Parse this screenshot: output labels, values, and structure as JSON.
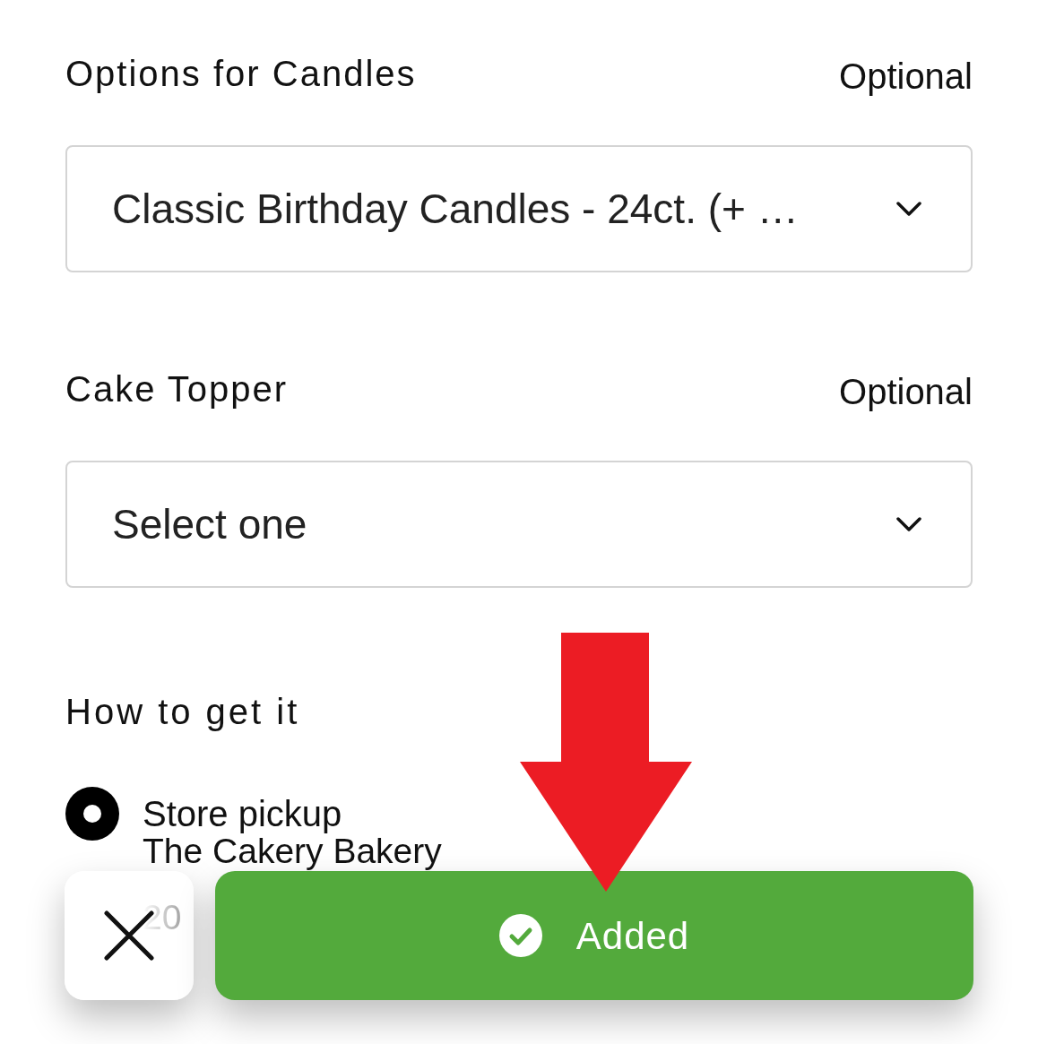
{
  "sections": [
    {
      "title": "Options for Candles",
      "note": "Optional",
      "select": {
        "value": "Classic Birthday Candles - 24ct. (+ …"
      }
    },
    {
      "title": "Cake Topper",
      "note": "Optional",
      "select": {
        "placeholder": "Select one"
      }
    }
  ],
  "delivery": {
    "title": "How to get it",
    "options": [
      {
        "label": "Store pickup",
        "selected": true,
        "details": [
          "The Cakery Bakery",
          "20"
        ]
      }
    ]
  },
  "action_bar": {
    "added_label": "Added"
  }
}
